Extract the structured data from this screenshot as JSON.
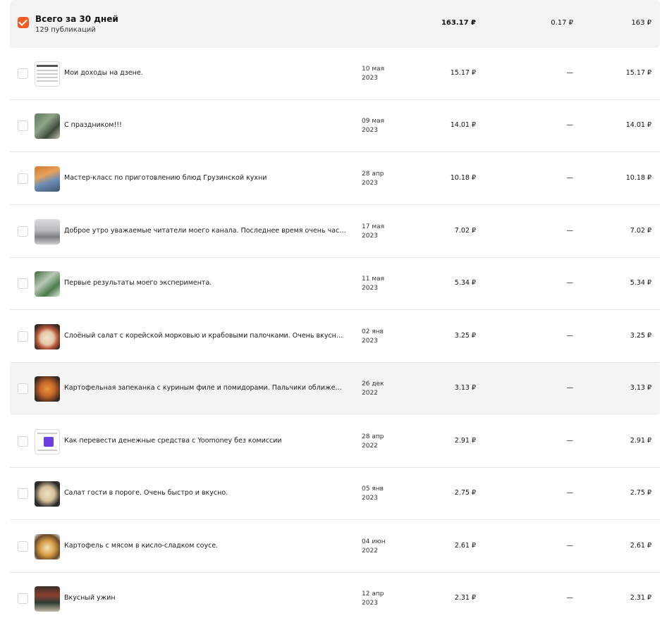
{
  "summary": {
    "title": "Всего за 30 дней",
    "subtitle": "129 публикаций",
    "col_a": "163.17 ₽",
    "col_b": "0.17 ₽",
    "col_c": "163 ₽",
    "checked": true,
    "accent_color": "#f25b26"
  },
  "rows": [
    {
      "title": "Мои доходы на дзене.",
      "date_line1": "10 мая",
      "date_line2": "2023",
      "col_a": "15.17 ₽",
      "col_b": "—",
      "col_c": "15.17 ₽",
      "thumbnail": "screenshot-thumbnail"
    },
    {
      "title": "С праздником!!!",
      "date_line1": "09 мая",
      "date_line2": "2023",
      "col_a": "14.01 ₽",
      "col_b": "—",
      "col_c": "14.01 ₽",
      "thumbnail": "monument-photo-thumbnail"
    },
    {
      "title": "Мастер-класс по приготовлению блюд Грузинской кухни",
      "date_line1": "28 апр",
      "date_line2": "2023",
      "col_a": "10.18 ₽",
      "col_b": "—",
      "col_c": "10.18 ₽",
      "thumbnail": "cooking-class-thumbnail"
    },
    {
      "title": "Доброе утро уважаемые читатели моего канала. Последнее время очень часто...",
      "date_line1": "17 мая",
      "date_line2": "2023",
      "col_a": "7.02 ₽",
      "col_b": "—",
      "col_c": "7.02 ₽",
      "thumbnail": "snow-street-thumbnail"
    },
    {
      "title": "Первые результаты моего эксперимента.",
      "date_line1": "11 мая",
      "date_line2": "2023",
      "col_a": "5.34 ₽",
      "col_b": "—",
      "col_c": "5.34 ₽",
      "thumbnail": "plants-thumbnail"
    },
    {
      "title": "Слоёный салат с корейской морковью и крабовыми палочками. Очень вкусно!!!",
      "date_line1": "02 янв",
      "date_line2": "2023",
      "col_a": "3.25 ₽",
      "col_b": "—",
      "col_c": "3.25 ₽",
      "thumbnail": "salad-thumbnail"
    },
    {
      "title": "Картофельная запеканка с куриным филе и помидорами. Пальчики оближешь.",
      "date_line1": "26 дек",
      "date_line2": "2022",
      "col_a": "3.13 ₽",
      "col_b": "—",
      "col_c": "3.13 ₽",
      "thumbnail": "casserole-thumbnail"
    },
    {
      "title": "Как перевести денежные средства с Yoomoney без комиссии",
      "date_line1": "28 апр",
      "date_line2": "2022",
      "col_a": "2.91 ₽",
      "col_b": "—",
      "col_c": "2.91 ₽",
      "thumbnail": "app-screenshot-thumbnail"
    },
    {
      "title": "Салат гости в пороге. Очень быстро и вкусно.",
      "date_line1": "05 янв",
      "date_line2": "2023",
      "col_a": "2.75 ₽",
      "col_b": "—",
      "col_c": "2.75 ₽",
      "thumbnail": "salad-pan-thumbnail"
    },
    {
      "title": "Картофель с мясом в кисло-сладком соусе.",
      "date_line1": "04 июн",
      "date_line2": "2022",
      "col_a": "2.61 ₽",
      "col_b": "—",
      "col_c": "2.61 ₽",
      "thumbnail": "potato-dish-thumbnail"
    },
    {
      "title": "Вкусный ужин",
      "date_line1": "12 апр",
      "date_line2": "2023",
      "col_a": "2.31 ₽",
      "col_b": "—",
      "col_c": "2.31 ₽",
      "thumbnail": "dinner-tray-thumbnail"
    }
  ]
}
